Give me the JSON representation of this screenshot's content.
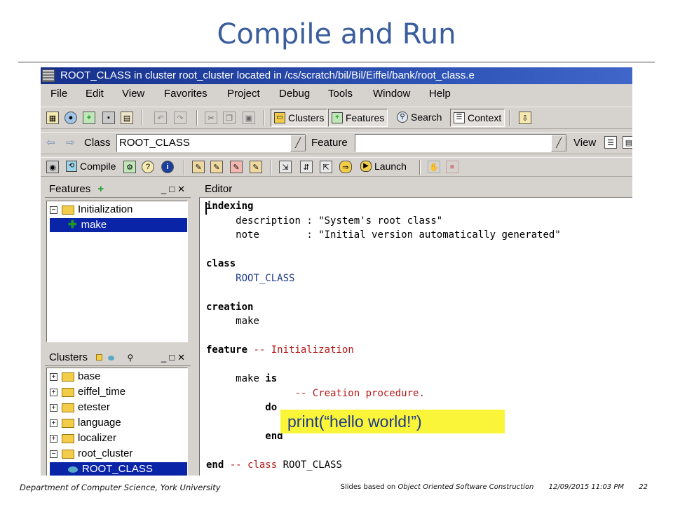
{
  "slide": {
    "title": "Compile and Run",
    "footer_left": "Department of Computer Science, York University",
    "footer_credit_prefix": "Slides based on",
    "footer_credit_book": "Object Oriented Software Construction",
    "footer_datetime": "12/09/2015 11:03 PM",
    "footer_page": "22"
  },
  "window": {
    "title": "ROOT_CLASS  in cluster root_cluster   located in /cs/scratch/bil/Bil/Eiffel/bank/root_class.e",
    "menu": [
      "File",
      "Edit",
      "View",
      "Favorites",
      "Project",
      "Debug",
      "Tools",
      "Window",
      "Help"
    ]
  },
  "toolbar": {
    "clusters": "Clusters",
    "features": "Features",
    "search": "Search",
    "context": "Context"
  },
  "classbar": {
    "class_label": "Class",
    "class_value": "ROOT_CLASS",
    "feature_label": "Feature",
    "feature_value": "",
    "view_label": "View"
  },
  "runbar": {
    "compile": "Compile",
    "launch": "Launch"
  },
  "features_panel": {
    "title": "Features",
    "group": "Initialization",
    "item": "make"
  },
  "clusters_panel": {
    "title": "Clusters",
    "items": [
      "base",
      "eiffel_time",
      "etester",
      "language",
      "localizer",
      "root_cluster"
    ],
    "selected": "ROOT_CLASS"
  },
  "editor": {
    "title": "Editor",
    "code": {
      "l1_kw": "indexing",
      "l2_name": "description",
      "l2_value": "\"System's root class\"",
      "l3_name": "note",
      "l3_value": "\"Initial version automatically generated\"",
      "l5_kw": "class",
      "l6_cls": "ROOT_CLASS",
      "l8_kw": "creation",
      "l9_name": "make",
      "l11_kw": "feature",
      "l11_cm": "-- Initialization",
      "l13_name": "make",
      "l13_kw": "is",
      "l14_cm": "-- Creation procedure.",
      "l15_kw": "do",
      "l17_kw": "end",
      "l18_kw": "end",
      "l18_cm": "-- class",
      "l18_cls": "ROOT_CLASS"
    }
  },
  "callout": {
    "text": "print(“hello world!”)"
  }
}
